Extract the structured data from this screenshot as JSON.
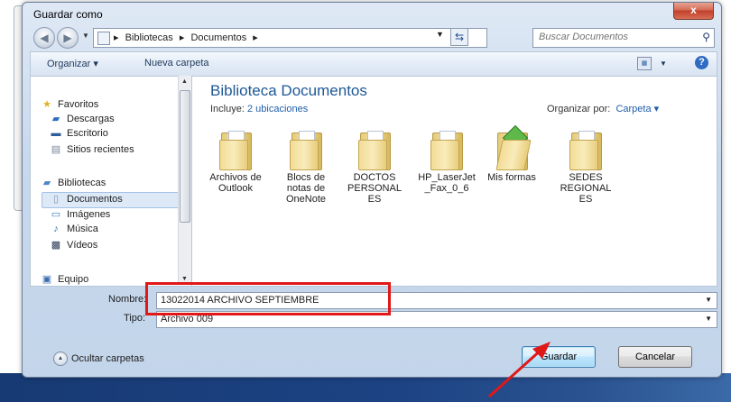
{
  "window": {
    "title": "Guardar como",
    "close_glyph": "x"
  },
  "address_bar": {
    "crumbs": [
      "Bibliotecas",
      "Documentos"
    ],
    "separator": "▸"
  },
  "search": {
    "placeholder": "Buscar Documentos"
  },
  "toolbar": {
    "organize": "Organizar ▾",
    "new_folder": "Nueva carpeta",
    "help": "?"
  },
  "nav": {
    "favorites": "Favoritos",
    "downloads": "Descargas",
    "desktop": "Escritorio",
    "recent": "Sitios recientes",
    "libraries": "Bibliotecas",
    "documents": "Documentos",
    "images": "Imágenes",
    "music": "Música",
    "videos": "Vídeos",
    "computer": "Equipo"
  },
  "library": {
    "title": "Biblioteca Documentos",
    "includes_label": "Incluye:",
    "includes_link": "2 ubicaciones",
    "arrange_label": "Organizar por:",
    "arrange_value": "Carpeta ▾"
  },
  "folders": [
    {
      "label": "Archivos de Outlook"
    },
    {
      "label": "Blocs de notas de OneNote"
    },
    {
      "label": "DOCTOS PERSONALES"
    },
    {
      "label": "HP_LaserJet _Fax_0_6"
    },
    {
      "label": "Mis formas"
    },
    {
      "label": "SEDES REGIONALES"
    }
  ],
  "form": {
    "name_label": "Nombre:",
    "name_value": "13022014 ARCHIVO SEPTIEMBRE",
    "type_label": "Tipo:",
    "type_value": "Archivo 009"
  },
  "footer": {
    "hide_folders": "Ocultar carpetas",
    "save": "Guardar",
    "cancel": "Cancelar"
  },
  "colors": {
    "highlight_box": "#e01818",
    "arrow": "#e01818",
    "library_title": "#1e5896"
  }
}
